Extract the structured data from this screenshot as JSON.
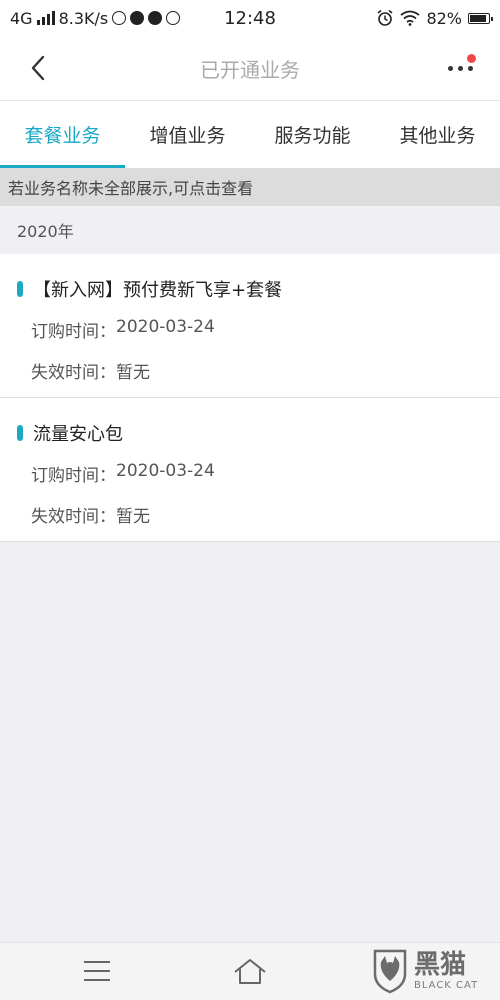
{
  "status_bar": {
    "network": "4G",
    "speed": "8.3K/s",
    "time": "12:48",
    "battery": "82%"
  },
  "header": {
    "title": "已开通业务",
    "back_icon": "chevron-left-icon",
    "more_icon": "more-dots-icon"
  },
  "tabs": [
    {
      "label": "套餐业务",
      "active": true
    },
    {
      "label": "增值业务",
      "active": false
    },
    {
      "label": "服务功能",
      "active": false
    },
    {
      "label": "其他业务",
      "active": false
    }
  ],
  "notice": "若业务名称未全部展示,可点击查看",
  "year_group": "2020年",
  "services": [
    {
      "name": "【新入网】预付费新飞享+套餐",
      "order_label": "订购时间：",
      "order_date": "2020-03-24",
      "expire_label": "失效时间：",
      "expire_value": "暂无"
    },
    {
      "name": "流量安心包",
      "order_label": "订购时间：",
      "order_date": "2020-03-24",
      "expire_label": "失效时间：",
      "expire_value": "暂无"
    }
  ],
  "watermark": {
    "cn": "黑猫",
    "en": "BLACK CAT"
  },
  "colors": {
    "accent": "#1ba9c8",
    "badge": "#f04848",
    "background": "#efeff4"
  }
}
